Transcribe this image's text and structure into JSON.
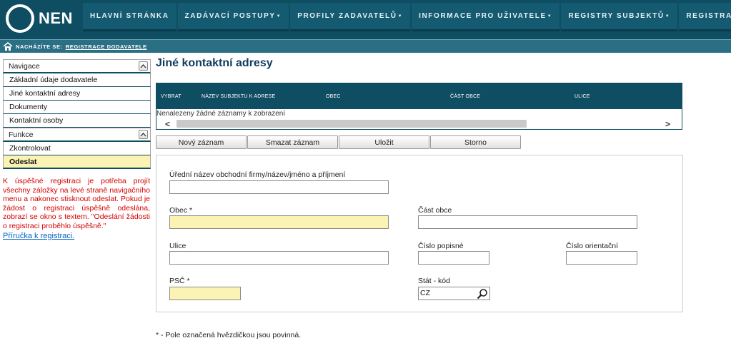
{
  "app": {
    "logo_text": "NEN"
  },
  "nav": {
    "items": [
      {
        "label": "HLAVNÍ STRÁNKA",
        "has_menu": false
      },
      {
        "label": "ZADÁVACÍ POSTUPY",
        "has_menu": true
      },
      {
        "label": "PROFILY ZADAVATELŮ",
        "has_menu": true
      },
      {
        "label": "INFORMACE PRO UŽIVATELE",
        "has_menu": true
      },
      {
        "label": "REGISTRY SUBJEKTŮ",
        "has_menu": true
      },
      {
        "label": "REGISTRACE",
        "has_menu": true
      }
    ]
  },
  "breadcrumb": {
    "label": "NACHÁZÍTE SE:",
    "link": "REGISTRACE DODAVATELE"
  },
  "sidebar": {
    "nav_section": "Navigace",
    "nav_items": [
      "Základní údaje dodavatele",
      "Jiné kontaktní adresy",
      "Dokumenty",
      "Kontaktní osoby"
    ],
    "func_section": "Funkce",
    "func_items": [
      "Zkontrolovat",
      "Odeslat"
    ],
    "help_text": "K úspěšné registraci je potřeba projít všechny záložky na levé straně navigačního menu a nakonec stisknout odeslat. Pokud je žádost o registraci úspěšně odeslána, zobrazí se okno s textem. \"Odeslání žádosti o registraci proběhlo úspěšně.\"",
    "help_link": "Příručka k registraci."
  },
  "main": {
    "title": "Jiné kontaktní adresy",
    "grid": {
      "columns": [
        "VYBRAT",
        "NÁZEV SUBJEKTU K ADRESE",
        "OBEC",
        "ČÁST OBCE",
        "ULICE"
      ],
      "empty_text": "Nenalezeny žádné záznamy k zobrazení"
    },
    "buttons": {
      "new": "Nový záznam",
      "delete": "Smazat záznam",
      "save": "Uložit",
      "cancel": "Storno"
    },
    "form": {
      "official_name_label": "Úřední název obchodní firmy/název/jméno a příjmení",
      "official_name_value": "",
      "city_label": "Obec *",
      "city_value": "",
      "city_part_label": "Část obce",
      "city_part_value": "",
      "street_label": "Ulice",
      "street_value": "",
      "house_number_label": "Číslo popisné",
      "house_number_value": "",
      "orientation_number_label": "Číslo orientační",
      "orientation_number_value": "",
      "zip_label": "PSČ *",
      "zip_value": "",
      "country_label": "Stát - kód",
      "country_value": "CZ"
    },
    "footnote": "* - Pole označená hvězdičkou jsou povinná."
  },
  "colors": {
    "header": "#0e4d62",
    "required_field": "#fbf3b4",
    "title": "#0f3b5f",
    "help_text": "#d40000"
  }
}
